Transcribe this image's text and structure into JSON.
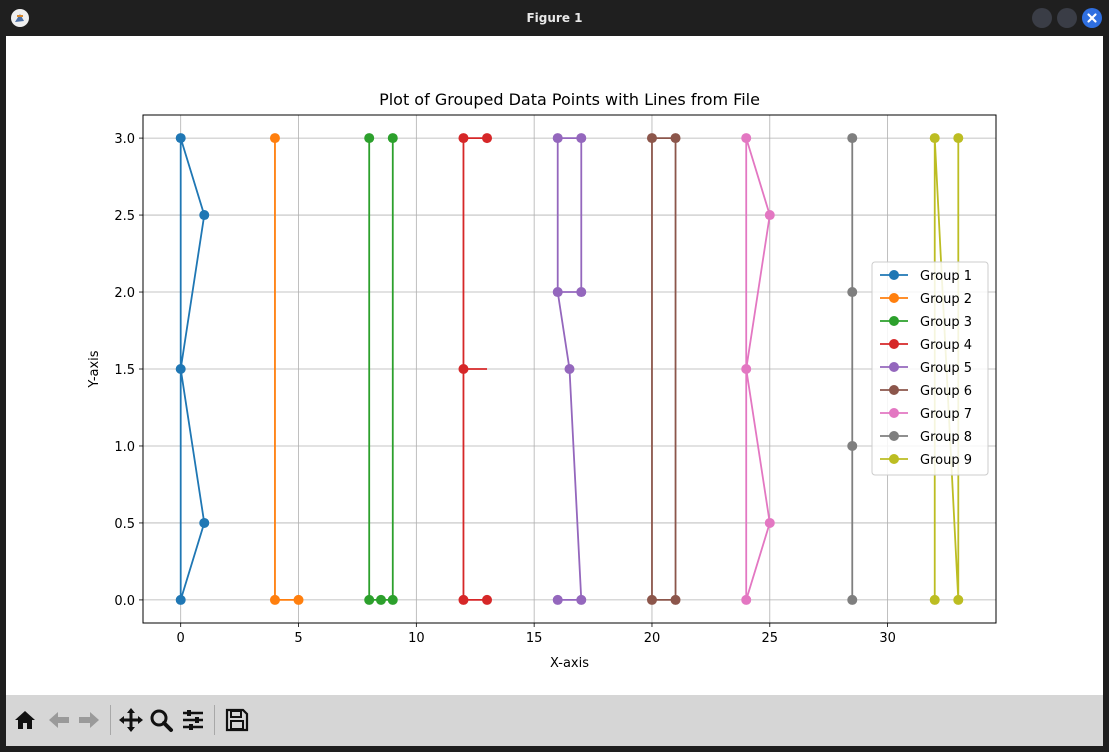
{
  "window": {
    "title": "Figure 1"
  },
  "toolbar": {
    "buttons": [
      {
        "name": "home-icon"
      },
      {
        "name": "back-icon"
      },
      {
        "name": "forward-icon"
      },
      {
        "name": "pan-icon"
      },
      {
        "name": "zoom-icon"
      },
      {
        "name": "configure-subplots-icon"
      },
      {
        "name": "save-icon"
      }
    ]
  },
  "chart_data": {
    "type": "line",
    "title": "Plot of Grouped Data Points with Lines from File",
    "xlabel": "X-axis",
    "ylabel": "Y-axis",
    "xlim": [
      -1.6,
      34.6
    ],
    "ylim": [
      -0.15,
      3.15
    ],
    "xticks": [
      0,
      5,
      10,
      15,
      20,
      25,
      30
    ],
    "xtick_labels": [
      "0",
      "5",
      "10",
      "15",
      "20",
      "25",
      "30"
    ],
    "yticks": [
      0.0,
      0.5,
      1.0,
      1.5,
      2.0,
      2.5,
      3.0
    ],
    "ytick_labels": [
      "0.0",
      "0.5",
      "1.0",
      "1.5",
      "2.0",
      "2.5",
      "3.0"
    ],
    "grid": true,
    "legend_position": "center-right",
    "series": [
      {
        "name": "Group 1",
        "color": "#1f77b4",
        "x": [
          0,
          1,
          0,
          1,
          0,
          0
        ],
        "y": [
          0,
          0.5,
          1.5,
          2.5,
          3,
          0
        ]
      },
      {
        "name": "Group 2",
        "color": "#ff7f0e",
        "x": [
          4,
          4,
          5
        ],
        "y": [
          3,
          0,
          0
        ]
      },
      {
        "name": "Group 3",
        "color": "#2ca02c",
        "x": [
          8,
          8,
          8.5,
          9,
          9
        ],
        "y": [
          3,
          0,
          0,
          0,
          3
        ]
      },
      {
        "name": "Group 4",
        "color": "#d62728",
        "x": [
          13,
          12,
          12,
          12,
          13
        ],
        "y": [
          3,
          3,
          1.5,
          0,
          0
        ],
        "extra_segments": [
          {
            "x": [
              12,
              13
            ],
            "y": [
              1.5,
              1.5
            ]
          }
        ]
      },
      {
        "name": "Group 5",
        "color": "#9467bd",
        "x": [
          16,
          17,
          17,
          16,
          16.5,
          17,
          16
        ],
        "y": [
          3,
          3,
          2,
          2,
          1.5,
          0,
          0
        ],
        "extra_segments": [
          {
            "x": [
              16,
              16
            ],
            "y": [
              3,
              2
            ]
          }
        ]
      },
      {
        "name": "Group 6",
        "color": "#8c564b",
        "x": [
          20,
          20,
          21,
          21,
          20
        ],
        "y": [
          0,
          3,
          3,
          0,
          0
        ]
      },
      {
        "name": "Group 7",
        "color": "#e377c2",
        "x": [
          24,
          24,
          25,
          24,
          25,
          24
        ],
        "y": [
          0,
          3,
          2.5,
          1.5,
          0.5,
          0
        ]
      },
      {
        "name": "Group 8",
        "color": "#7f7f7f",
        "x": [
          28.5,
          28.5,
          28.5,
          28.5
        ],
        "y": [
          0,
          1,
          2,
          3
        ]
      },
      {
        "name": "Group 9",
        "color": "#bcbd22",
        "x": [
          32,
          32,
          33,
          33
        ],
        "y": [
          0,
          3,
          0,
          3
        ]
      }
    ]
  }
}
